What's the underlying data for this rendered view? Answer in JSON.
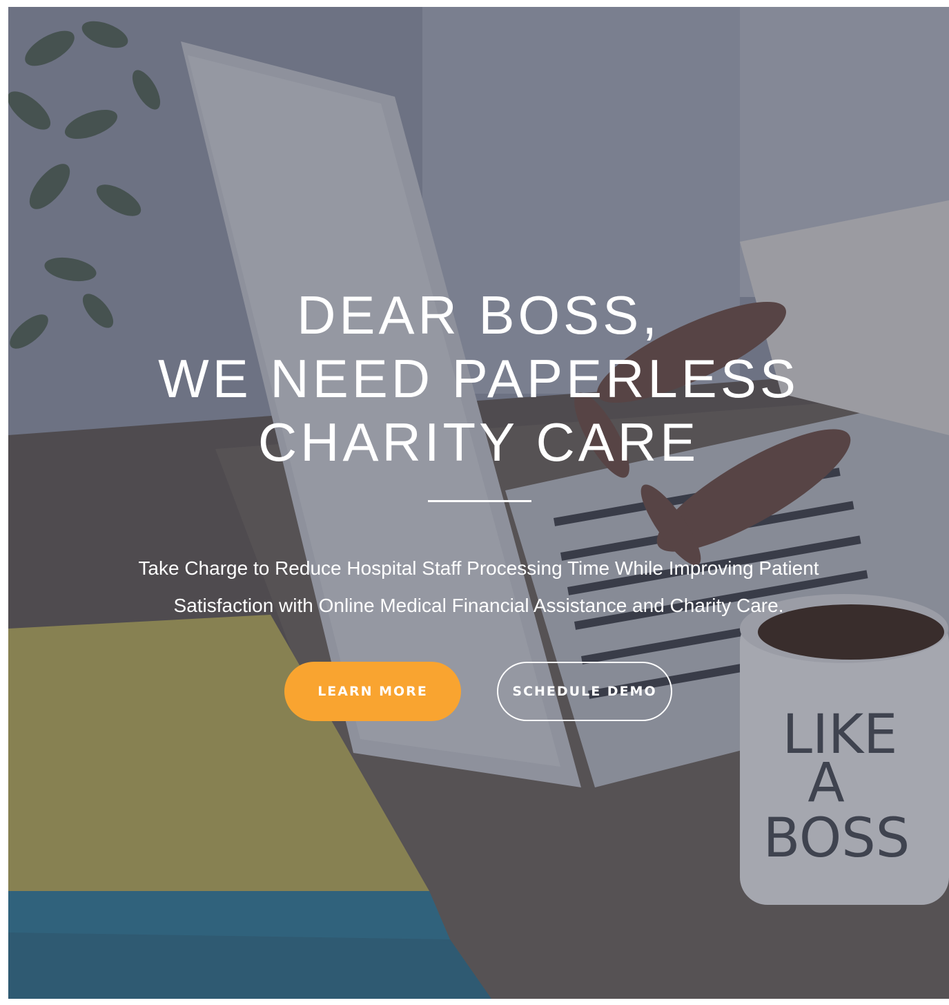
{
  "hero": {
    "background_image": "laptop-desk-photo",
    "headline_lines": [
      "DEAR BOSS,",
      "WE NEED PAPERLESS",
      "CHARITY CARE"
    ],
    "subtitle_lines": [
      "Take Charge to Reduce Hospital Staff Processing Time While Improving Patient",
      "Satisfaction with Online Medical Financial Assistance and Charity Care."
    ],
    "mug_text": [
      "LIKE",
      "A",
      "BOSS"
    ],
    "buttons": {
      "learn_more": "LEARN MORE",
      "schedule_demo": "SCHEDULE DEMO"
    }
  },
  "colors": {
    "accent_orange": "#f9a430",
    "overlay": "#373c50",
    "text": "#ffffff"
  }
}
